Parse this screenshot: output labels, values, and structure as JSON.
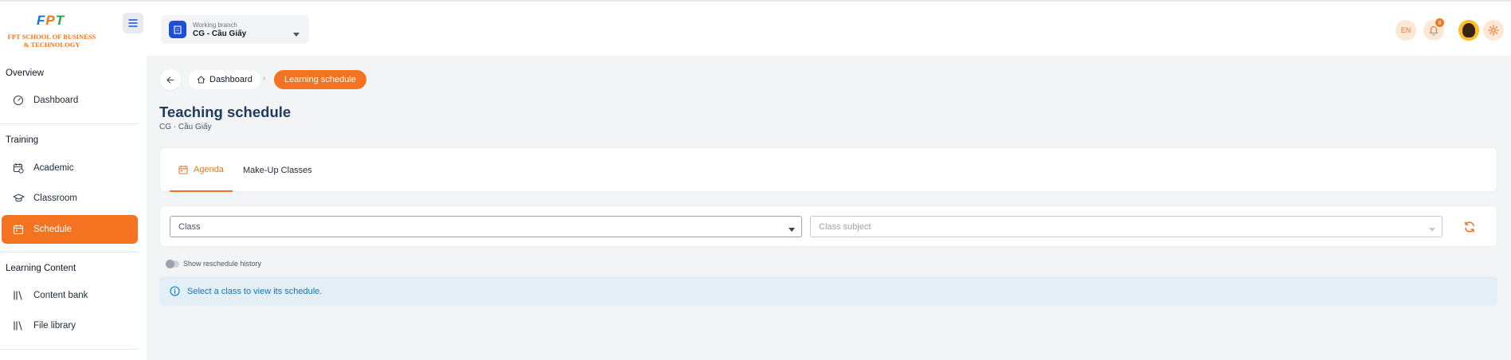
{
  "logo": {
    "text": "FPT SCHOOL OF BUSINESS & TECHNOLOGY"
  },
  "sidebar": {
    "sections": [
      {
        "title": "Overview"
      },
      {
        "title": "Training"
      },
      {
        "title": "Learning Content"
      }
    ],
    "items": [
      {
        "label": "Dashboard",
        "icon": "gauge-icon"
      },
      {
        "label": "Academic",
        "icon": "calendar-clock-icon"
      },
      {
        "label": "Classroom",
        "icon": "graduation-cap-icon"
      },
      {
        "label": "Schedule",
        "icon": "calendar-icon",
        "active": true
      },
      {
        "label": "Content bank",
        "icon": "library-icon"
      },
      {
        "label": "File library",
        "icon": "library-icon"
      }
    ]
  },
  "topbar": {
    "branch_label": "Working branch",
    "branch_value": "CG - Cầu Giấy",
    "language": "EN",
    "notification_count": "8"
  },
  "breadcrumb": {
    "home": "Dashboard",
    "current": "Learning schedule"
  },
  "page": {
    "title": "Teaching schedule",
    "subtitle": "CG · Cầu Giấy"
  },
  "tabs": [
    {
      "label": "Agenda",
      "active": true
    },
    {
      "label": "Make-Up Classes",
      "active": false
    }
  ],
  "filters": {
    "class_placeholder": "Class",
    "subject_placeholder": "Class subject"
  },
  "toggle": {
    "label": "Show reschedule history",
    "on": false
  },
  "alert": {
    "text": "Select a class to view its schedule."
  },
  "colors": {
    "accent": "#f47321",
    "title": "#1e3a5f",
    "info": "#0b7abd",
    "info_bg": "#e3eef5"
  }
}
